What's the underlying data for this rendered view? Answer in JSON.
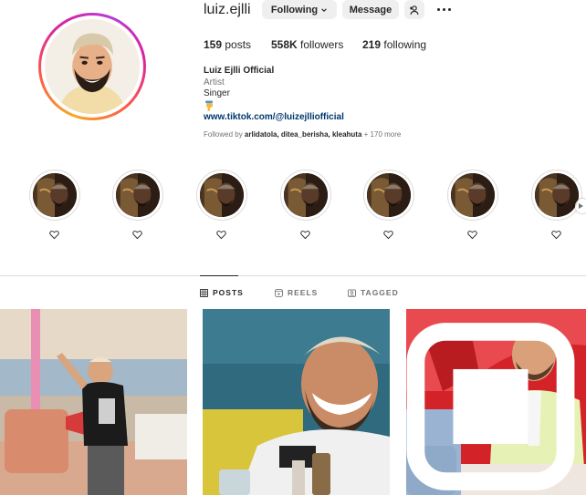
{
  "profile": {
    "username": "luiz.ejlli",
    "following_button": "Following",
    "message_button": "Message",
    "posts_count": "159",
    "posts_label": "posts",
    "followers_count": "558K",
    "followers_label": "followers",
    "following_count": "219",
    "following_label": "following",
    "display_name": "Luiz Ejlli Official",
    "category": "Artist",
    "bio_line": "Singer",
    "bio_emoji": "hand-pointing-down",
    "link": "www.tiktok.com/@luizejlliofficial",
    "followed_by_prefix": "Followed by",
    "followed_by_names": "arlidatola, ditea_berisha, kleahuta",
    "followed_by_more": "+ 170 more"
  },
  "highlights": [
    {
      "icon": "heart-icon"
    },
    {
      "icon": "heart-icon"
    },
    {
      "icon": "heart-icon"
    },
    {
      "icon": "heart-icon"
    },
    {
      "icon": "heart-icon"
    },
    {
      "icon": "heart-icon"
    },
    {
      "icon": "heart-icon"
    }
  ],
  "tabs": [
    {
      "label": "POSTS",
      "icon": "grid-icon",
      "active": true
    },
    {
      "label": "REELS",
      "icon": "reels-icon",
      "active": false
    },
    {
      "label": "TAGGED",
      "icon": "tagged-icon",
      "active": false
    }
  ],
  "colors": {
    "text": "#262626",
    "muted": "#737373",
    "link": "#00376b",
    "button_bg": "#efefef",
    "divider": "#dbdbdb"
  }
}
